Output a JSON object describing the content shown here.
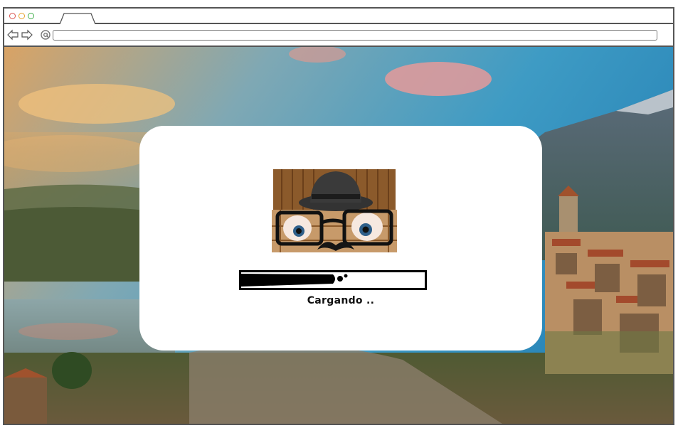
{
  "browser": {
    "window_buttons": [
      "close",
      "minimize",
      "maximize"
    ],
    "back_icon": "back-arrow-icon",
    "forward_icon": "forward-arrow-icon",
    "site_icon": "at-sign-icon",
    "address": ""
  },
  "loader": {
    "status_text": "Cargando ..",
    "progress": 0.5,
    "mascot": "wooden-house-with-fedora-hat-glasses-eyes-and-mustache"
  },
  "colors": {
    "close": "#d9534f",
    "minimize": "#e8a32c",
    "maximize": "#3fae49",
    "dialog_bg": "#ffffff",
    "progress_fill": "#000000"
  }
}
